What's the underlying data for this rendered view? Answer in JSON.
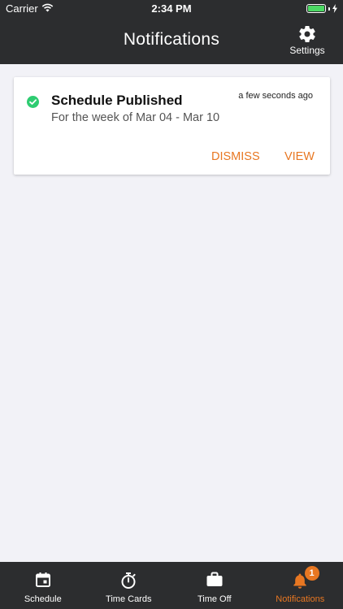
{
  "status_bar": {
    "carrier": "Carrier",
    "time": "2:34 PM"
  },
  "nav": {
    "title": "Notifications",
    "settings_label": "Settings"
  },
  "notification": {
    "title": "Schedule Published",
    "subtitle": "For the week of Mar 04 - Mar 10",
    "timestamp": "a few seconds ago",
    "dismiss_label": "DISMISS",
    "view_label": "VIEW",
    "status_icon": "check-circle-icon"
  },
  "tabbar": {
    "tabs": [
      {
        "label": "Schedule",
        "icon": "calendar-icon",
        "active": false
      },
      {
        "label": "Time Cards",
        "icon": "stopwatch-icon",
        "active": false
      },
      {
        "label": "Time Off",
        "icon": "briefcase-icon",
        "active": false
      },
      {
        "label": "Notifications",
        "icon": "bell-icon",
        "active": true,
        "badge": "1"
      }
    ]
  },
  "colors": {
    "header_bg": "#2c2d2f",
    "accent": "#e87722",
    "success": "#2ecc71",
    "page_bg": "#f2f2f7"
  }
}
